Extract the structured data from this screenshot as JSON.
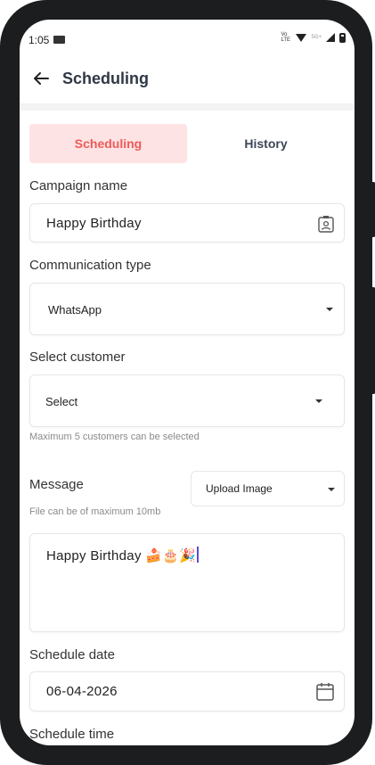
{
  "status_bar": {
    "time": "1:05",
    "network_label": "5G+",
    "volte_label": "Vo LTE"
  },
  "app_bar": {
    "title": "Scheduling"
  },
  "tabs": [
    {
      "label": "Scheduling",
      "active": true
    },
    {
      "label": "History",
      "active": false
    }
  ],
  "form": {
    "campaign_name": {
      "label": "Campaign name",
      "value": "Happy Birthday"
    },
    "communication_type": {
      "label": "Communication type",
      "value": "WhatsApp"
    },
    "select_customer": {
      "label": "Select customer",
      "value": "Select",
      "hint": "Maximum 5 customers can be selected"
    },
    "message": {
      "label": "Message",
      "upload_label": "Upload Image",
      "hint": "File can be of maximum 10mb",
      "value": "Happy Birthday 🍰🎂🎉"
    },
    "schedule_date": {
      "label": "Schedule date",
      "value": "06-04-2026"
    },
    "schedule_time": {
      "label": "Schedule time"
    }
  },
  "colors": {
    "accent": "#ee5a5a",
    "accent_bg": "#fde3e3",
    "frame": "#1b1d1f"
  },
  "icons": [
    "back-arrow-icon",
    "contact-card-icon",
    "calendar-icon",
    "dropdown-caret-icon",
    "mail-icon",
    "wifi-icon",
    "cell-signal-icon",
    "battery-icon"
  ]
}
